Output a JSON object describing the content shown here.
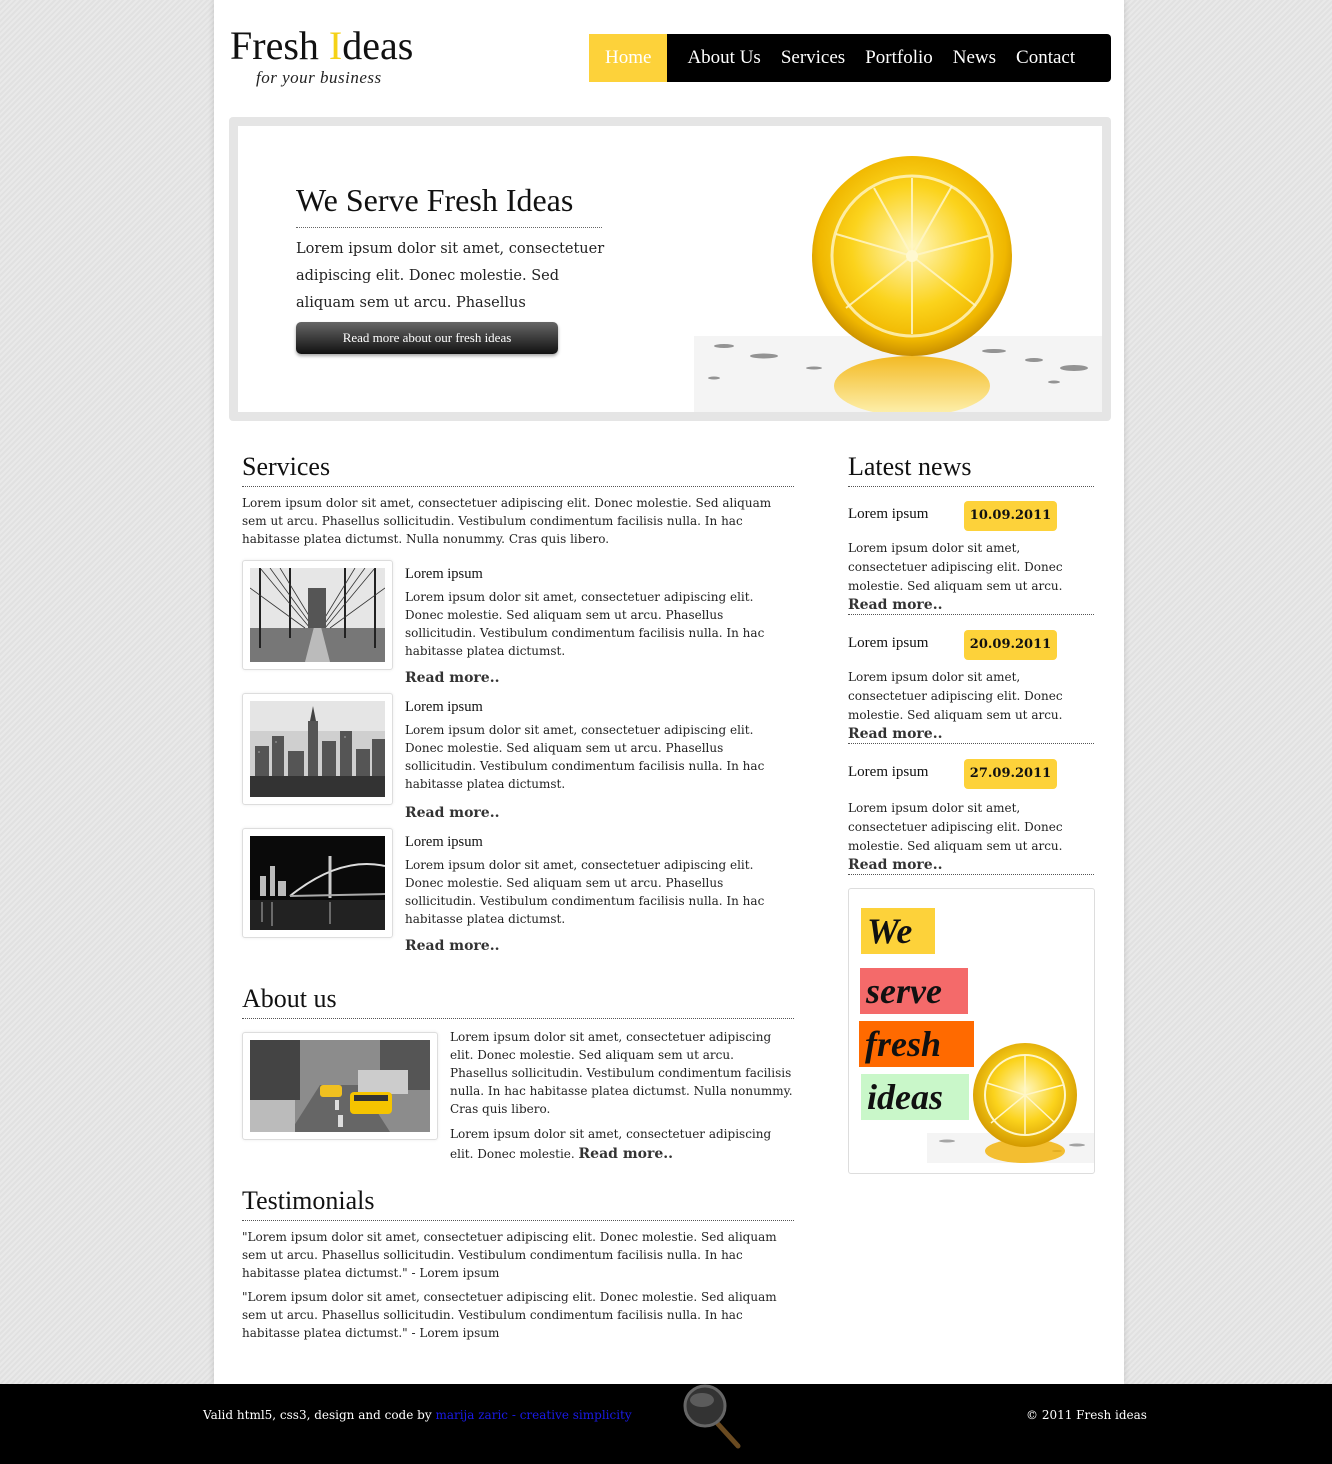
{
  "logo": {
    "title_part1": "Fresh ",
    "title_hl": "I",
    "title_part2": "deas",
    "tagline": "for your business"
  },
  "nav": {
    "items": [
      "Home",
      "About Us",
      "Services",
      "Portfolio",
      "News",
      "Contact"
    ],
    "active": "Home"
  },
  "hero": {
    "title": "We Serve Fresh Ideas",
    "text": "Lorem ipsum dolor sit amet, consectetuer adipiscing elit. Donec molestie. Sed aliquam sem ut arcu. Phasellus sollicitudin.",
    "button": "Read more about our fresh ideas"
  },
  "services": {
    "heading": "Services",
    "intro": "Lorem ipsum dolor sit amet, consectetuer adipiscing elit. Donec molestie. Sed aliquam sem ut arcu. Phasellus sollicitudin. Vestibulum condimentum facilisis nulla. In hac habitasse platea dictumst. Nulla nonummy. Cras quis libero.",
    "items": [
      {
        "title": "Lorem ipsum",
        "text": "Lorem ipsum dolor sit amet, consectetuer adipiscing elit. Donec molestie. Sed aliquam sem ut arcu. Phasellus sollicitudin. Vestibulum condimentum facilisis nulla. In hac habitasse platea dictumst.",
        "link": "Read more.."
      },
      {
        "title": "Lorem ipsum",
        "text": "Lorem ipsum dolor sit amet, consectetuer adipiscing elit. Donec molestie. Sed aliquam sem ut arcu. Phasellus sollicitudin. Vestibulum condimentum facilisis nulla. In hac habitasse platea dictumst.",
        "link": "Read more.."
      },
      {
        "title": "Lorem ipsum",
        "text": "Lorem ipsum dolor sit amet, consectetuer adipiscing elit. Donec molestie. Sed aliquam sem ut arcu. Phasellus sollicitudin. Vestibulum condimentum facilisis nulla. In hac habitasse platea dictumst.",
        "link": "Read more.."
      }
    ]
  },
  "about": {
    "heading": "About us",
    "text1": "Lorem ipsum dolor sit amet, consectetuer adipiscing elit. Donec molestie. Sed aliquam sem ut arcu. Phasellus sollicitudin. Vestibulum condimentum facilisis nulla. In hac habitasse platea dictumst. Nulla nonummy. Cras quis libero.",
    "text2": "Lorem ipsum dolor sit amet, consectetuer adipiscing elit. Donec molestie.",
    "link": "Read more.."
  },
  "testimonials": {
    "heading": "Testimonials",
    "items": [
      "\"Lorem ipsum dolor sit amet, consectetuer adipiscing elit. Donec molestie. Sed aliquam sem ut arcu. Phasellus sollicitudin. Vestibulum condimentum facilisis nulla. In hac habitasse platea dictumst.\" - Lorem ipsum",
      "\"Lorem ipsum dolor sit amet, consectetuer adipiscing elit. Donec molestie. Sed aliquam sem ut arcu. Phasellus sollicitudin. Vestibulum condimentum facilisis nulla. In hac habitasse platea dictumst.\" - Lorem ipsum"
    ]
  },
  "news": {
    "heading": "Latest news",
    "items": [
      {
        "title": "Lorem ipsum",
        "date": "10.09.2011",
        "text": "Lorem ipsum dolor sit amet, consectetuer adipiscing elit. Donec molestie. Sed aliquam sem ut arcu.",
        "link": "Read more.."
      },
      {
        "title": "Lorem ipsum",
        "date": "20.09.2011",
        "text": "Lorem ipsum dolor sit amet, consectetuer adipiscing elit. Donec molestie. Sed aliquam sem ut arcu.",
        "link": "Read more.."
      },
      {
        "title": "Lorem ipsum",
        "date": "27.09.2011",
        "text": "Lorem ipsum dolor sit amet, consectetuer adipiscing elit. Donec molestie. Sed aliquam sem ut arcu.",
        "link": "Read more.."
      }
    ]
  },
  "ad": {
    "words": [
      "We",
      "serve",
      "fresh",
      "ideas"
    ],
    "colors": [
      "#fdd23a",
      "#f46a6a",
      "#ff6a00",
      "#c9f7c9"
    ]
  },
  "footer": {
    "left_text": "Valid html5, css3, design and code by ",
    "left_link": "marija zaric - creative simplicity",
    "right_text": "© 2011 Fresh ideas"
  },
  "colors": {
    "accent": "#fdd23a",
    "nav_bg": "#000000",
    "footer_bg": "#000000",
    "link": "#1a1ae6"
  }
}
